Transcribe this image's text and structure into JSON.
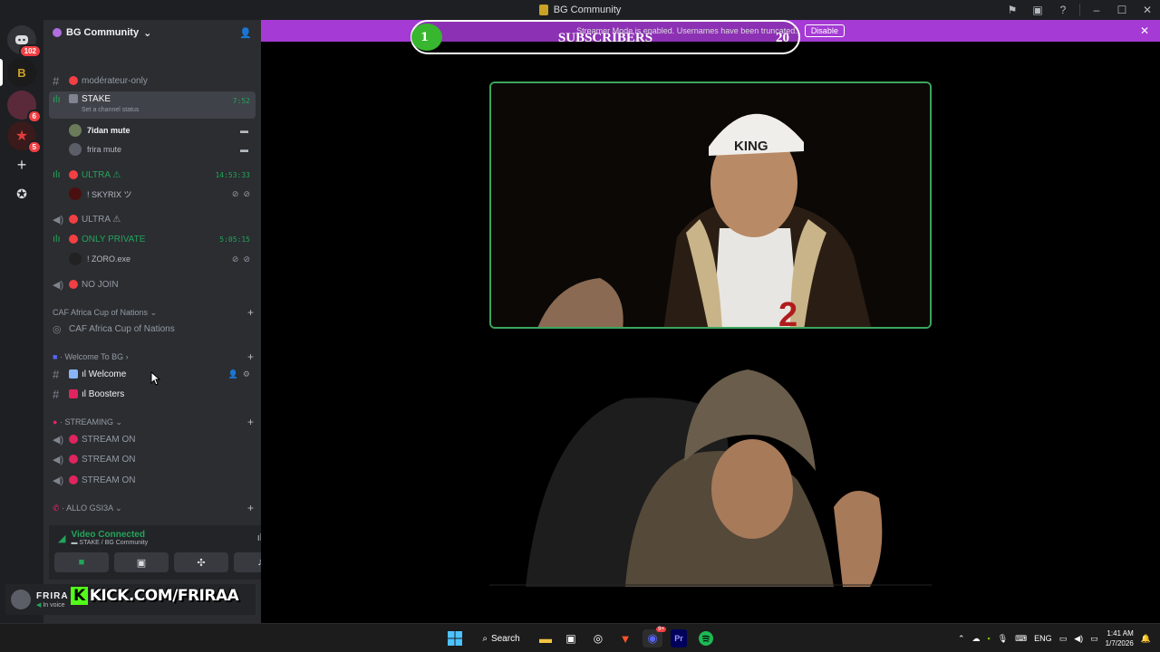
{
  "window": {
    "title": "BG Community"
  },
  "streamer_banner": {
    "text": "Streamer Mode is enabled. Usernames have been truncated.",
    "button": "Disable"
  },
  "overlay": {
    "count": "1",
    "label": "SUBSCRIBERS",
    "goal": "20"
  },
  "rail": {
    "home_badge": "102",
    "badge_a": "6",
    "badge_b": "5"
  },
  "server": {
    "name": "BG Community"
  },
  "channels": {
    "moderator": "modérateur-only",
    "stake": "STAKE",
    "stake_timer": "7:52",
    "stake_status": "Set a channel status",
    "user1": "7idan mute",
    "user2": "frira mute",
    "ultra1": "ULTRA ⚠",
    "ultra1_timer": "14:53:33",
    "skyrix": "! SKYRIX ツ",
    "ultra2": "ULTRA ⚠",
    "only_private": "ONLY PRIVATE",
    "only_private_timer": "5:05:15",
    "zoro": "! ZORO.exe",
    "no_join": "NO JOIN",
    "cat_caf": "CAF Africa Cup of Nations",
    "caf_channel": "CAF Africa Cup of Nations",
    "cat_welcome": "Welcome To BG",
    "welcome": "Welcome",
    "boosters": "Boosters",
    "cat_streaming": "STREAMING",
    "stream1": "STREAM ON",
    "stream2": "STREAM ON",
    "stream3": "STREAM ON",
    "cat_allo": "ALLO GSI3A"
  },
  "voice": {
    "status": "Video Connected",
    "location": "STAKE / BG Community"
  },
  "user": {
    "name": "FRIRA",
    "status": "In voice"
  },
  "kick_overlay": {
    "k": "K",
    "text": "KICK.COM/FRIRAA"
  },
  "taskbar": {
    "search": "Search",
    "lang": "ENG",
    "time": "1:41 AM",
    "date": "1/7/2026",
    "discord_badge": "9+"
  },
  "colors": {
    "accent_green": "#23a55a",
    "streamer_purple": "#a53ad4",
    "kick_green": "#53fc18"
  }
}
